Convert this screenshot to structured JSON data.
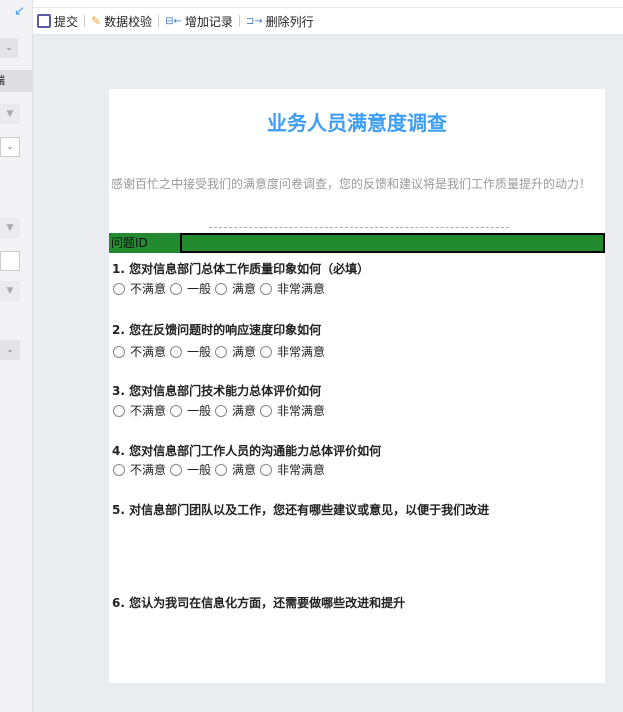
{
  "toolbar": {
    "submit": "提交",
    "validate": "数据校验",
    "add_record": "增加记录",
    "delete_row": "删除列行"
  },
  "left_panel": {
    "label": "端"
  },
  "form": {
    "title": "业务人员满意度调查",
    "intro": "感谢百忙之中接受我们的满意度问卷调查，您的反馈和建议将是我们工作质量提升的动力！",
    "id_label": "问题ID",
    "options": [
      "不满意",
      "一般",
      "满意",
      "非常满意"
    ],
    "questions": [
      "1. 您对信息部门总体工作质量印象如何（必填）",
      "2. 您在反馈问题时的响应速度印象如何",
      "3. 您对信息部门技术能力总体评价如何",
      "4. 您对信息部门工作人员的沟通能力总体评价如何",
      "5. 对信息部门团队以及工作，您还有哪些建议或意见，以便于我们改进",
      "6. 您认为我司在信息化方面，还需要做哪些改进和提升"
    ]
  }
}
